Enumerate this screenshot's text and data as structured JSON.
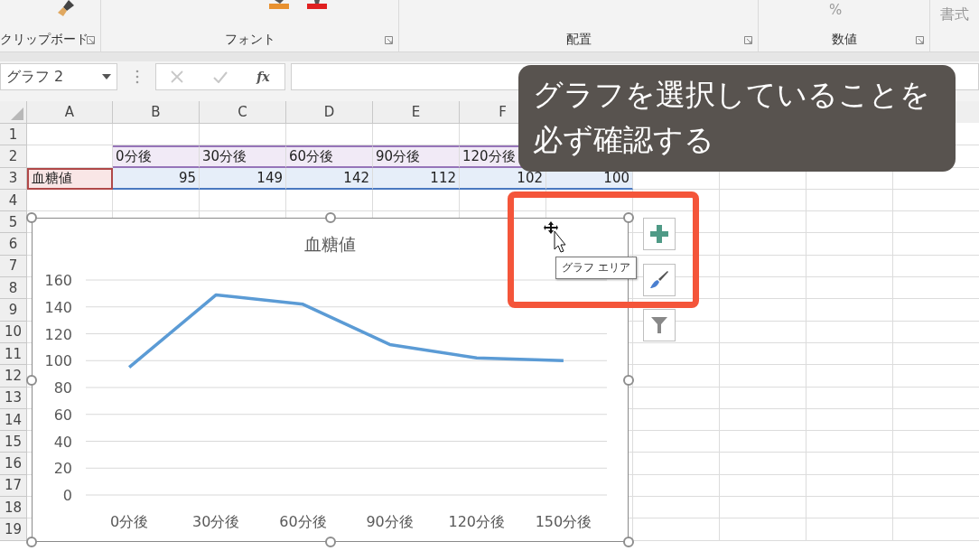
{
  "ribbon": {
    "groups": [
      {
        "label": "クリップボード"
      },
      {
        "label": "フォント"
      },
      {
        "label": "配置"
      },
      {
        "label": "数値"
      }
    ],
    "percent": "%",
    "format_button": "書式"
  },
  "formula_bar": {
    "name_box": "グラフ 2",
    "function_label": "fx"
  },
  "columns": [
    "A",
    "B",
    "C",
    "D",
    "E",
    "F"
  ],
  "rows": [
    {
      "label": "1"
    },
    {
      "label": "2",
      "cells": [
        {
          "kind": "blank"
        },
        {
          "kind": "category",
          "text": "0分後"
        },
        {
          "kind": "category",
          "text": "30分後"
        },
        {
          "kind": "category",
          "text": "60分後"
        },
        {
          "kind": "category",
          "text": "90分後"
        },
        {
          "kind": "category",
          "text": "120分後"
        },
        {
          "kind": "category"
        }
      ]
    },
    {
      "label": "3",
      "cells": [
        {
          "kind": "series_name",
          "text": "血糖値"
        },
        {
          "kind": "value",
          "text": "95"
        },
        {
          "kind": "value",
          "text": "149"
        },
        {
          "kind": "value",
          "text": "142"
        },
        {
          "kind": "value",
          "text": "112"
        },
        {
          "kind": "value",
          "text": "102"
        },
        {
          "kind": "value",
          "text": "100"
        }
      ]
    },
    {
      "label": "4"
    },
    {
      "label": "5"
    },
    {
      "label": "6"
    },
    {
      "label": "7"
    },
    {
      "label": "8"
    },
    {
      "label": "9"
    },
    {
      "label": "10"
    },
    {
      "label": "11"
    },
    {
      "label": "12"
    },
    {
      "label": "13"
    },
    {
      "label": "14"
    },
    {
      "label": "15"
    },
    {
      "label": "16"
    },
    {
      "label": "17"
    },
    {
      "label": "18"
    },
    {
      "label": "19"
    }
  ],
  "chart": {
    "selected": true,
    "tooltip": "グラフ エリア",
    "chart_data": {
      "type": "line",
      "title": "血糖値",
      "categories": [
        "0分後",
        "30分後",
        "60分後",
        "90分後",
        "120分後",
        "150分後"
      ],
      "series": [
        {
          "color": "#5b9bd5",
          "values": [
            95,
            149,
            142,
            112,
            102,
            100
          ]
        }
      ],
      "grid": true,
      "ylim": [
        0,
        160
      ],
      "yticks": [
        0,
        20,
        40,
        60,
        80,
        100,
        120,
        140,
        160
      ]
    }
  },
  "callout": {
    "lines": [
      "グラフを選択していることを",
      "必ず確認する"
    ]
  }
}
